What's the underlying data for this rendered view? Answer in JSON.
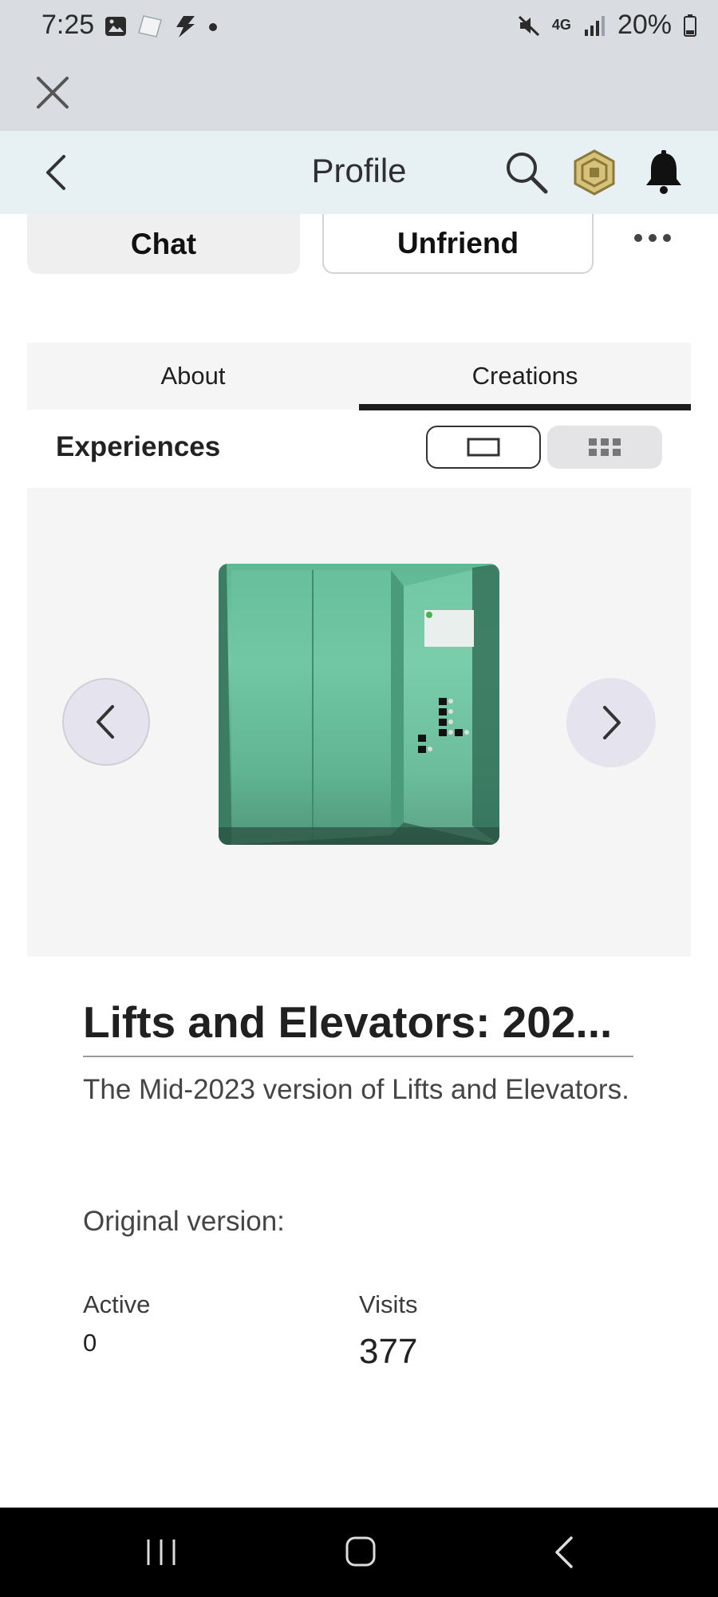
{
  "status_bar": {
    "time": "7:25",
    "battery": "20%",
    "network": "4G"
  },
  "header": {
    "title": "Profile"
  },
  "actions": {
    "chat": "Chat",
    "unfriend": "Unfriend"
  },
  "tabs": [
    {
      "label": "About",
      "selected": false
    },
    {
      "label": "Creations",
      "selected": true
    }
  ],
  "section": {
    "title": "Experiences"
  },
  "experience": {
    "title": "Lifts and Elevators: 202...",
    "description": "The Mid-2023 version of Lifts and Elevators.",
    "original_version": "Original version:",
    "stats": {
      "active_label": "Active",
      "active_value": "0",
      "visits_label": "Visits",
      "visits_value": "377"
    }
  },
  "colors": {
    "accent": "#1b1b1b",
    "header_bg": "#e7f0f2",
    "status_bg": "#d9dde1",
    "thumbnail_green": "#6cbf9e"
  }
}
